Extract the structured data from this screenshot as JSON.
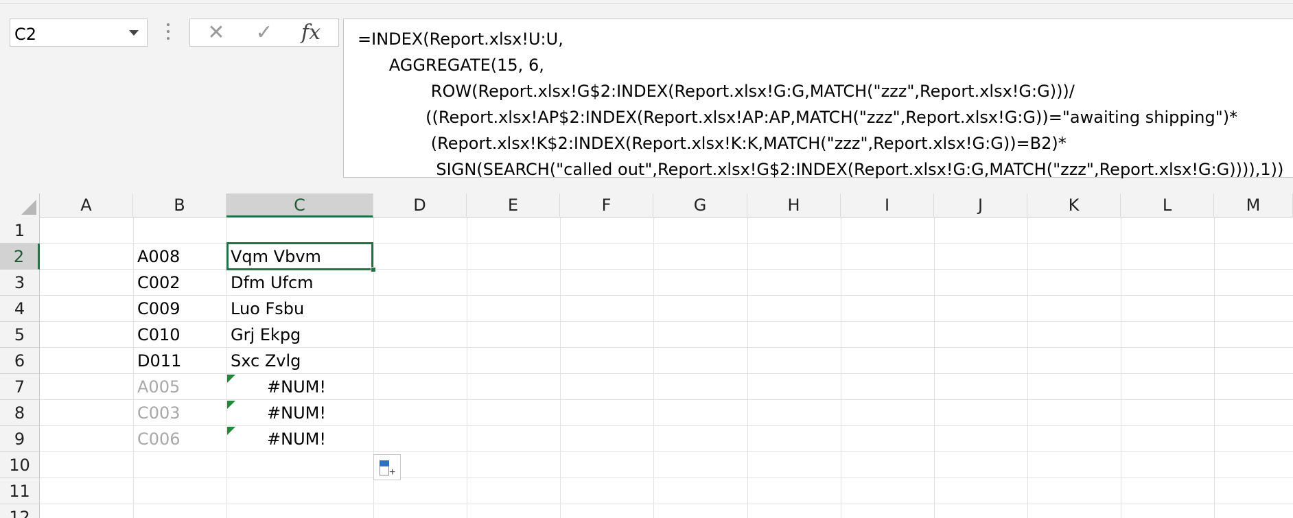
{
  "name_box": {
    "value": "C2"
  },
  "formula_bar": {
    "cancel_icon": "✕",
    "enter_icon": "✓",
    "fx_label": "fx",
    "formula": "=INDEX(Report.xlsx!U:U,\n      AGGREGATE(15, 6,\n              ROW(Report.xlsx!G$2:INDEX(Report.xlsx!G:G,MATCH(\"zzz\",Report.xlsx!G:G)))/\n             ((Report.xlsx!AP$2:INDEX(Report.xlsx!AP:AP,MATCH(\"zzz\",Report.xlsx!G:G))=\"awaiting shipping\")*\n              (Report.xlsx!K$2:INDEX(Report.xlsx!K:K,MATCH(\"zzz\",Report.xlsx!G:G))=B2)*\n               SIGN(SEARCH(\"called out\",Report.xlsx!G$2:INDEX(Report.xlsx!G:G,MATCH(\"zzz\",Report.xlsx!G:G)))),1))"
  },
  "columns": [
    "A",
    "B",
    "C",
    "D",
    "E",
    "F",
    "G",
    "H",
    "I",
    "J",
    "K",
    "L",
    "M"
  ],
  "rows": [
    "1",
    "2",
    "3",
    "4",
    "5",
    "6",
    "7",
    "8",
    "9",
    "10",
    "11",
    "12"
  ],
  "selected_column": "C",
  "selected_row": "2",
  "cells": {
    "B2": "A008",
    "C2": "Vqm Vbvm",
    "B3": "C002",
    "C3": "Dfm Ufcm",
    "B4": "C009",
    "C4": "Luo Fsbu",
    "B5": "C010",
    "C5": "Grj Ekpg",
    "B6": "D011",
    "C6": "Sxc Zvlg",
    "B7": "A005",
    "C7": "#NUM!",
    "B8": "C003",
    "C8": "#NUM!",
    "B9": "C006",
    "C9": "#NUM!"
  },
  "colors": {
    "accent": "#217346",
    "error_indicator": "#1e8a3a"
  },
  "icons": {
    "name_box_dropdown": "chevron-down-icon",
    "quick_analysis": "quick-analysis-icon"
  }
}
